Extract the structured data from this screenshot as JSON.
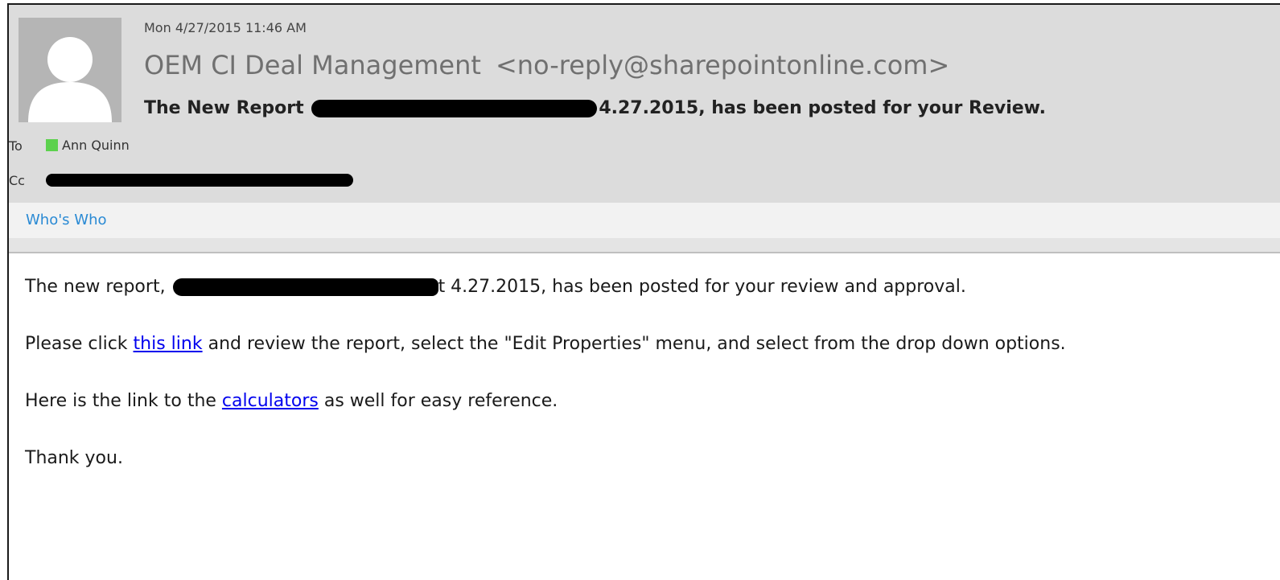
{
  "message": {
    "timestamp": "Mon 4/27/2015 11:46 AM",
    "sender_name": "OEM CI Deal Management",
    "sender_email": "<no-reply@sharepointonline.com>",
    "subject_prefix": "The New Report",
    "subject_suffix": "4.27.2015, has been posted for your Review."
  },
  "recipients": {
    "to_label": "To",
    "to_name": "Ann Quinn",
    "cc_label": "Cc"
  },
  "whos_who": "Who's Who",
  "body": {
    "p1_prefix": "The new report,",
    "p1_suffix": "t 4.27.2015, has been posted for your review and approval.",
    "p2_before": "Please click ",
    "p2_link": "this link",
    "p2_after": " and review the report, select the \"Edit Properties\" menu, and select from the drop down options.",
    "p3_before": "Here is the link to the ",
    "p3_link": "calculators",
    "p3_after": " as well for easy reference.",
    "p4": "Thank you."
  },
  "colors": {
    "header_bg": "#dcdcdc",
    "link": "#0000ee",
    "whos_who_link": "#2a8ad4",
    "presence_available": "#5cd14d"
  }
}
